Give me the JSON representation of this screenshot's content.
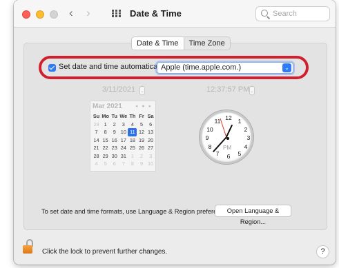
{
  "window": {
    "title": "Date & Time",
    "nav_back": "‹",
    "nav_forward": "›"
  },
  "search": {
    "placeholder": "Search"
  },
  "tabs": [
    {
      "label": "Date & Time",
      "selected": true
    },
    {
      "label": "Time Zone",
      "selected": false
    }
  ],
  "auto_time": {
    "checked": true,
    "label": "Set date and time automatically:",
    "server_value": "Apple (time.apple.com.)"
  },
  "date_field": {
    "value": "3/11/2021",
    "stepper": "⌃⌄"
  },
  "time_field": {
    "value": "12:37:57 PM",
    "stepper": "⌃⌄"
  },
  "calendar": {
    "month_label": "Mar 2021",
    "nav": "◂ ● ▸",
    "weekdays": [
      "Su",
      "Mo",
      "Tu",
      "We",
      "Th",
      "Fr",
      "Sa"
    ],
    "weeks": [
      [
        "28",
        "1",
        "2",
        "3",
        "4",
        "5",
        "6"
      ],
      [
        "7",
        "8",
        "9",
        "10",
        "11",
        "12",
        "13"
      ],
      [
        "14",
        "15",
        "16",
        "17",
        "18",
        "19",
        "20"
      ],
      [
        "21",
        "22",
        "23",
        "24",
        "25",
        "26",
        "27"
      ],
      [
        "28",
        "29",
        "30",
        "31",
        "1",
        "2",
        "3"
      ],
      [
        "4",
        "5",
        "6",
        "7",
        "8",
        "9",
        "10"
      ]
    ],
    "selected_day": "11"
  },
  "clock": {
    "numbers": [
      "12",
      "1",
      "2",
      "3",
      "4",
      "5",
      "6",
      "7",
      "8",
      "9",
      "10",
      "11"
    ],
    "period": "PM"
  },
  "formats": {
    "text": "To set date and time formats, use Language & Region preferences.",
    "button": "Open Language & Region..."
  },
  "lock": {
    "text": "Click the lock to prevent further changes."
  },
  "help": {
    "label": "?"
  },
  "colors": {
    "accent": "#2f7bf5",
    "highlight_ring": "#d0202e",
    "second_hand": "#d73727",
    "lock": "#f5a43c"
  },
  "icons": [
    "grid-icon",
    "search-icon",
    "chevron-down-icon",
    "lock-icon",
    "checkmark-icon"
  ]
}
